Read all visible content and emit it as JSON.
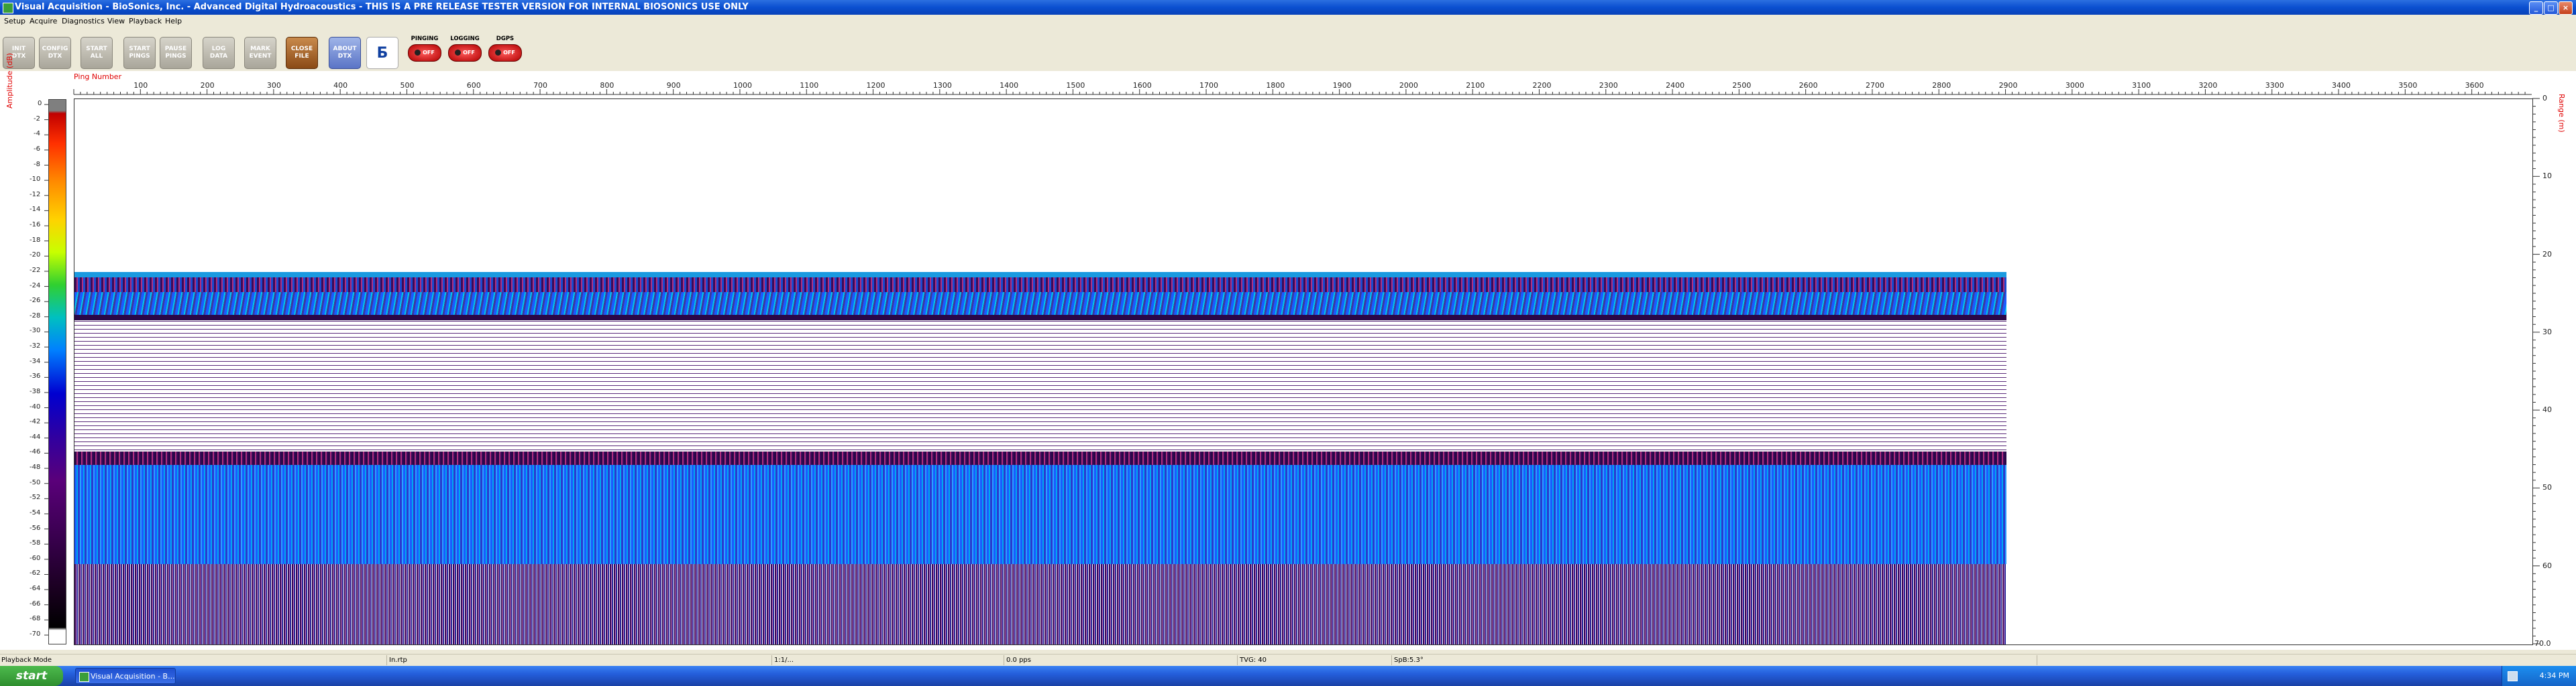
{
  "window": {
    "title": "Visual Acquisition  -  BioSonics, Inc.  -  Advanced Digital Hydroacoustics  -  THIS IS A PRE RELEASE TESTER VERSION FOR INTERNAL BIOSONICS USE ONLY",
    "min_icon": "_",
    "max_icon": "□",
    "close_icon": "×"
  },
  "menu": [
    "Setup",
    "Acquire",
    "Diagnostics",
    "View",
    "Playback",
    "Help"
  ],
  "toolbar": {
    "buttons": [
      {
        "label": "INIT\nDTX",
        "style": "grey"
      },
      {
        "label": "CONFIG\nDTX",
        "style": "grey"
      },
      {
        "label": "START\nALL",
        "style": "grey"
      },
      {
        "label": "START\nPINGS",
        "style": "grey"
      },
      {
        "label": "PAUSE\nPINGS",
        "style": "grey"
      },
      {
        "label": "LOG\nDATA",
        "style": "grey"
      },
      {
        "label": "MARK\nEVENT",
        "style": "grey"
      },
      {
        "label": "CLOSE\nFILE",
        "style": "brown"
      },
      {
        "label": "ABOUT\nDTX",
        "style": "blue"
      }
    ],
    "logo_icon": "biosonics-logo-icon",
    "status": [
      {
        "label": "PINGING",
        "state": "OFF"
      },
      {
        "label": "LOGGING",
        "state": "OFF"
      },
      {
        "label": "DGPS",
        "state": "OFF"
      }
    ]
  },
  "plot": {
    "x_axis_label": "Ping Number",
    "left_axis_label": "Amplitude (dB)",
    "right_axis_label": "Range (m)",
    "x_ticks": [
      100,
      200,
      300,
      400,
      500,
      600,
      700,
      800,
      900,
      1000,
      1100,
      1200,
      1300,
      1400,
      1500,
      1600,
      1700,
      1800,
      1900,
      2000,
      2100,
      2200,
      2300,
      2400,
      2500,
      2600,
      2700,
      2800,
      2900,
      3000,
      3100,
      3200,
      3300,
      3400,
      3500,
      3600
    ],
    "x_max": 3690,
    "ping_count": 2900,
    "amp_ticks": [
      "0",
      "-2",
      "-4",
      "-6",
      "-8",
      "-10",
      "-12",
      "-14",
      "-16",
      "-18",
      "-20",
      "-22",
      "-24",
      "-26",
      "-28",
      "-30",
      "-32",
      "-34",
      "-36",
      "-38",
      "-40",
      "-42",
      "-44",
      "-46",
      "-48",
      "-50",
      "-52",
      "-54",
      "-56",
      "-58",
      "-60",
      "-62",
      "-64",
      "-66",
      "-68",
      "-70"
    ],
    "range_ticks": [
      "0",
      "10",
      "20",
      "30",
      "40",
      "50",
      "60"
    ],
    "range_max": 70,
    "range_end_label": "70.0",
    "colors": {
      "blue_band": "#1a5bff",
      "purple": "#3a0a5a",
      "cyan": "#00c8e8"
    }
  },
  "status": {
    "mode": "Playback Mode",
    "file": "In.rtp",
    "time": "1:1/...",
    "rate": "0.0 pps",
    "tvg": "TVG: 40",
    "sp": "SpB:5.3°"
  },
  "taskbar": {
    "start": "start",
    "task": "Visual Acquisition  -  B...",
    "clock": "4:34 PM"
  }
}
